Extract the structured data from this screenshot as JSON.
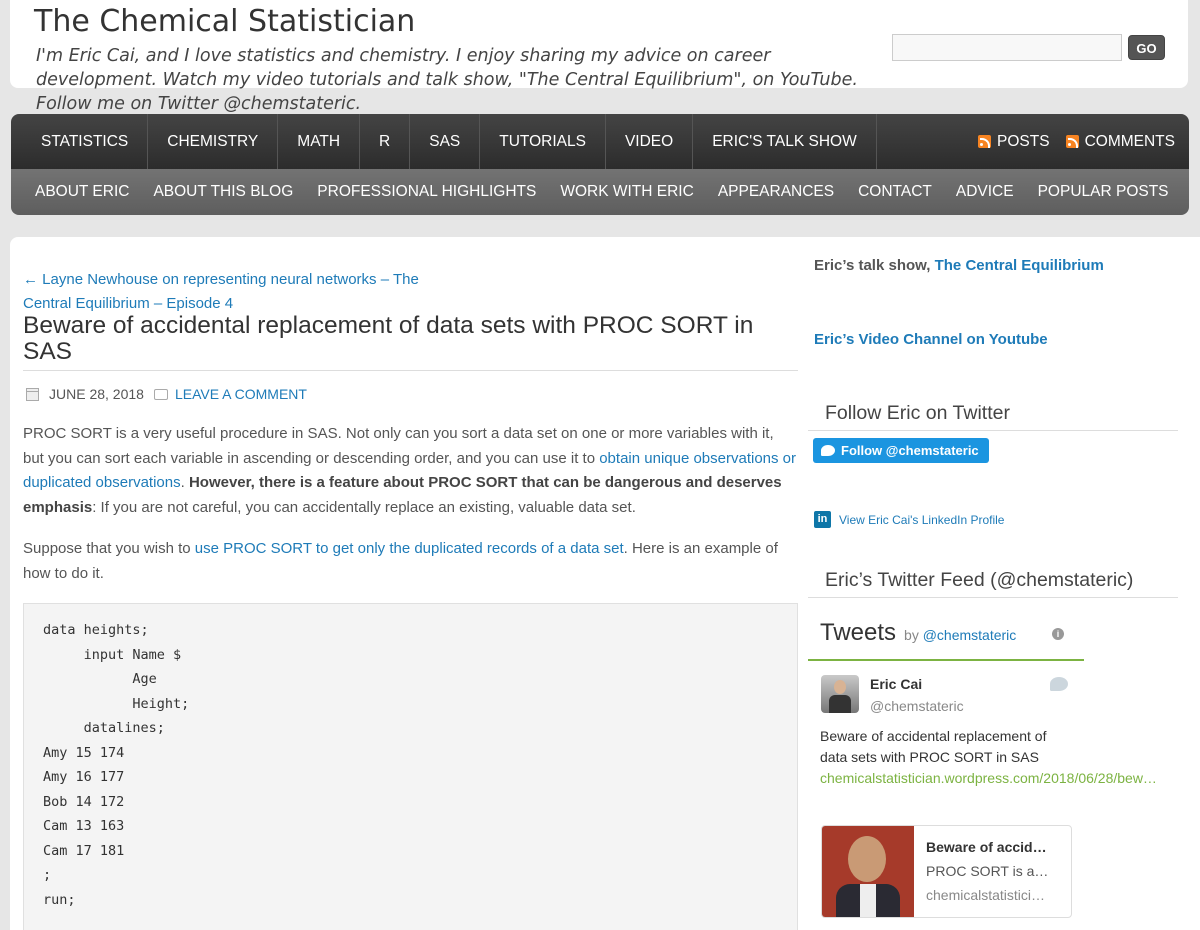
{
  "header": {
    "site_title": "The Chemical Statistician",
    "tagline": "I'm Eric Cai, and I love statistics and chemistry. I enjoy sharing my advice on career development. Watch my video tutorials and talk show, \"The Central Equilibrium\", on YouTube. Follow me on Twitter @chemstateric.",
    "search_placeholder": "",
    "search_button": "GO"
  },
  "nav": {
    "primary": [
      "STATISTICS",
      "CHEMISTRY",
      "MATH",
      "R",
      "SAS",
      "TUTORIALS",
      "VIDEO",
      "ERIC'S TALK SHOW"
    ],
    "feeds": [
      "POSTS",
      "COMMENTS"
    ],
    "secondary": [
      "ABOUT ERIC",
      "ABOUT THIS BLOG",
      "PROFESSIONAL HIGHLIGHTS",
      "WORK WITH ERIC",
      "APPEARANCES",
      "CONTACT",
      "ADVICE",
      "POPULAR POSTS"
    ]
  },
  "post": {
    "prev_link": "← Layne Newhouse on representing neural networks – The Central Equilibrium – Episode 4",
    "title": "Beware of accidental replacement of data sets with PROC SORT in SAS",
    "date": "JUNE 28, 2018",
    "comment_link": "LEAVE A COMMENT",
    "p1_a": "PROC SORT is a very useful procedure in SAS.  Not only can you sort a data set on one or more variables with it, but you can sort each variable in ascending or descending order, and you can use it to ",
    "p1_link": "obtain unique observations or duplicated observations",
    "p1_b": ".  ",
    "p1_bold": "However, there is a feature about PROC SORT that can be dangerous and deserves emphasis",
    "p1_c": ": If you are not careful, you can accidentally replace an existing, valuable data set.",
    "p2_a": "Suppose that you wish to ",
    "p2_link": "use PROC SORT to get only the duplicated records of a data set",
    "p2_b": ".  Here is an example of how to do it.",
    "code": [
      "data heights;",
      "     input Name $",
      "           Age",
      "           Height;",
      "     datalines;",
      "Amy 15 174",
      "Amy 16 177",
      "Bob 14 172",
      "Cam 13 163",
      "Cam 17 181",
      ";",
      "run;"
    ]
  },
  "sidebar": {
    "talk_show_prefix": "Eric’s talk show, ",
    "talk_show_link": "The Central Equilibrium",
    "video_channel": "Eric’s Video Channel on Youtube",
    "follow_heading": "Follow Eric on Twitter",
    "follow_button": "Follow @chemstateric",
    "linkedin": "View Eric Cai's LinkedIn Profile",
    "feed_heading": "Eric’s Twitter Feed (@chemstateric)",
    "tweets": {
      "title": "Tweets",
      "by": "by ",
      "by_handle": "@chemstateric",
      "name": "Eric Cai",
      "handle": "@chemstateric",
      "text": "Beware of accidental replacement of data sets with PROC SORT in SAS ",
      "url": "chemicalstatistician.wordpress.com/2018/06/28/bew…",
      "card_title": "Beware of accid…",
      "card_desc": "PROC SORT is a…",
      "card_url": "chemicalstatistici…"
    }
  }
}
